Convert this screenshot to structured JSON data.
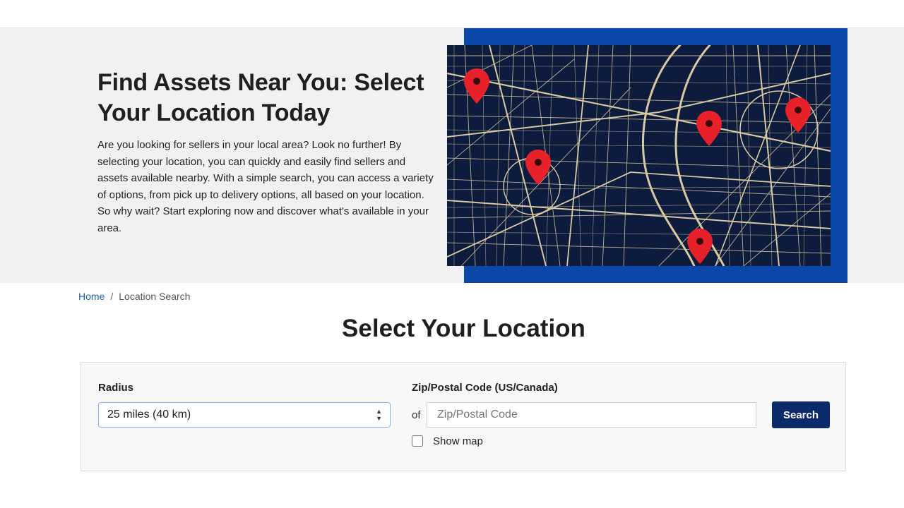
{
  "hero": {
    "title": "Find Assets Near You: Select Your Location Today",
    "description": "Are you looking for sellers in your local area? Look no further! By selecting your location, you can quickly and easily find sellers and assets available nearby. With a simple search, you can access a variety of options, from pick up to delivery options, all based on your location. So why wait? Start exploring now and discover what's available in your area.",
    "image_icon": "city-map-with-location-pins",
    "colors": {
      "frame": "#0a47a9",
      "map_bg": "#0d1b3d",
      "roads": "#d9c9a3",
      "pins": "#e8202a"
    }
  },
  "breadcrumb": {
    "home": "Home",
    "separator": "/",
    "current": "Location Search"
  },
  "section_title": "Select Your Location",
  "form": {
    "radius_label": "Radius",
    "radius_value": "25 miles (40 km)",
    "zip_label": "Zip/Postal Code (US/Canada)",
    "of_text": "of",
    "zip_placeholder": "Zip/Postal Code",
    "zip_value": "",
    "search_label": "Search",
    "show_map_label": "Show map",
    "show_map_checked": false,
    "button_color": "#0b2a6b"
  }
}
